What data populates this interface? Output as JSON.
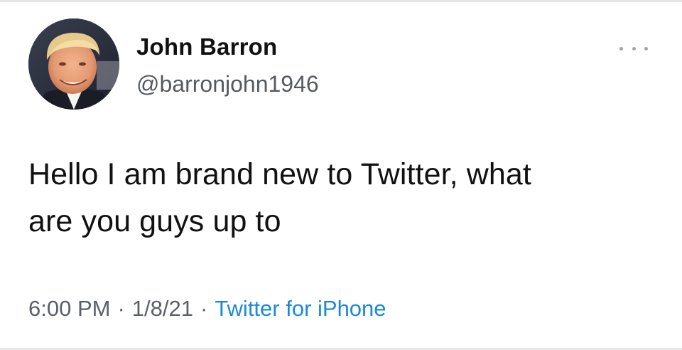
{
  "tweet": {
    "author": {
      "display_name": "John Barron",
      "handle": "@barronjohn1946",
      "avatar_icon": "profile-photo"
    },
    "more_icon": "more-horizontal-icon",
    "text_line1": "Hello I am brand new to Twitter, what",
    "text_line2": "are you guys up to",
    "time": "6:00 PM",
    "date": "1/8/21",
    "separator": "·",
    "source": "Twitter for iPhone"
  },
  "colors": {
    "link": "#1b8ad6",
    "meta_text": "#5b6068",
    "text": "#111111"
  }
}
